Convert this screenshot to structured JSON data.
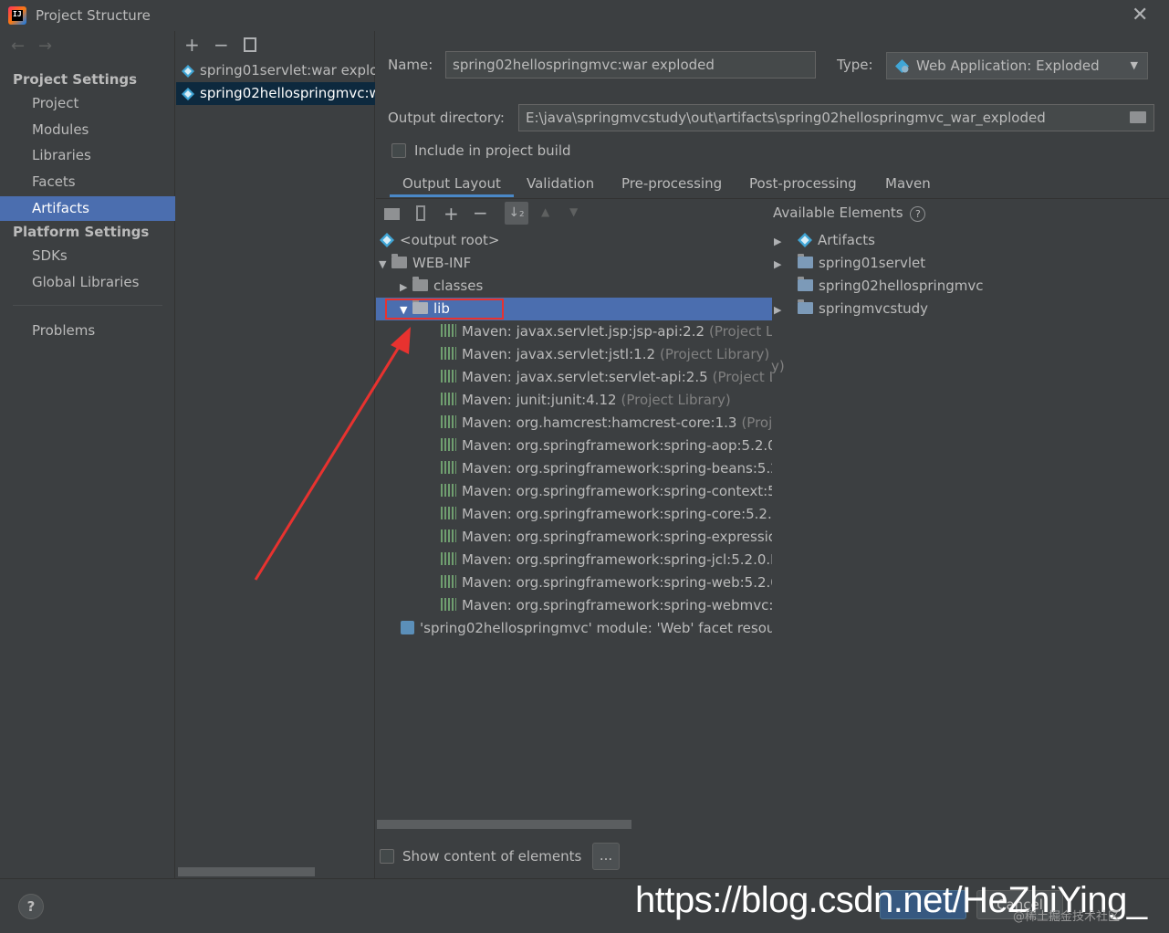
{
  "window": {
    "title": "Project Structure"
  },
  "left_nav": {
    "project_settings_header": "Project Settings",
    "project_settings_items": [
      "Project",
      "Modules",
      "Libraries",
      "Facets",
      "Artifacts"
    ],
    "platform_settings_header": "Platform Settings",
    "platform_settings_items": [
      "SDKs",
      "Global Libraries"
    ],
    "problems": "Problems",
    "selected": "Artifacts"
  },
  "artifacts_list": {
    "items": [
      "spring01servlet:war exploded",
      "spring02hellospringmvc:war exploded"
    ],
    "selected_index": 1
  },
  "editor": {
    "name_label": "Name:",
    "name_value": "spring02hellospringmvc:war exploded",
    "type_label": "Type:",
    "type_value": "Web Application: Exploded",
    "output_dir_label": "Output directory:",
    "output_dir_value": "E:\\java\\springmvcstudy\\out\\artifacts\\spring02hellospringmvc_war_exploded",
    "include_build_label": "Include in project build",
    "include_build_checked": false,
    "tabs": [
      "Output Layout",
      "Validation",
      "Pre-processing",
      "Post-processing",
      "Maven"
    ],
    "active_tab": "Output Layout",
    "available_elements_label": "Available Elements",
    "show_content_label": "Show content of elements",
    "show_content_checked": false,
    "more_button": "..."
  },
  "output_tree": {
    "root": "<output root>",
    "web_inf": "WEB-INF",
    "classes": "classes",
    "lib": "lib",
    "libraries": [
      {
        "name": "Maven: javax.servlet.jsp:jsp-api:2.2",
        "suffix": "(Project Libr"
      },
      {
        "name": "Maven: javax.servlet:jstl:1.2",
        "suffix": "(Project Library)"
      },
      {
        "name": "Maven: javax.servlet:servlet-api:2.5",
        "suffix": "(Project Library)"
      },
      {
        "name": "Maven: junit:junit:4.12",
        "suffix": "(Project Library)"
      },
      {
        "name": "Maven: org.hamcrest:hamcrest-core:1.3",
        "suffix": "(Projec"
      },
      {
        "name": "Maven: org.springframework:spring-aop:5.2.0.I",
        "suffix": ""
      },
      {
        "name": "Maven: org.springframework:spring-beans:5.2.",
        "suffix": ""
      },
      {
        "name": "Maven: org.springframework:spring-context:5.",
        "suffix": ""
      },
      {
        "name": "Maven: org.springframework:spring-core:5.2.0",
        "suffix": ""
      },
      {
        "name": "Maven: org.springframework:spring-expressior",
        "suffix": ""
      },
      {
        "name": "Maven: org.springframework:spring-jcl:5.2.0.RI",
        "suffix": ""
      },
      {
        "name": "Maven: org.springframework:spring-web:5.2.0.",
        "suffix": ""
      },
      {
        "name": "Maven: org.springframework:spring-webmvc:5",
        "suffix": ""
      }
    ],
    "facet_resource": "'spring02hellospringmvc' module: 'Web' facet resour"
  },
  "available_tree": {
    "items": [
      "Artifacts",
      "spring01servlet",
      "spring02hellospringmvc",
      "springmvcstudy"
    ]
  },
  "bottom": {
    "help": "?",
    "cancel": "Cancel",
    "watermark": "https://blog.csdn.net/HeZhiYing_",
    "watermark_small": "@稀土掘金技术社区"
  },
  "colors": {
    "background": "#3c3f41",
    "selection": "#4b6eaf",
    "list_selection": "#0d293e",
    "annotation_red": "#e8322f"
  }
}
